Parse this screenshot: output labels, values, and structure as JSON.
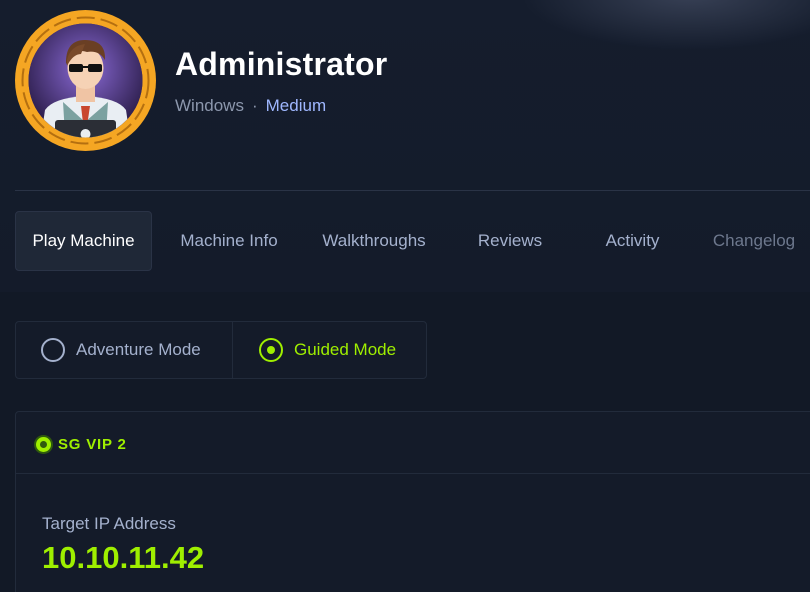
{
  "machine": {
    "name": "Administrator",
    "os": "Windows",
    "separator": "·",
    "difficulty": "Medium",
    "avatar_icon": "hacker-avatar-icon"
  },
  "tabs": [
    {
      "label": "Play Machine",
      "active": true
    },
    {
      "label": "Machine Info",
      "active": false
    },
    {
      "label": "Walkthroughs",
      "active": false
    },
    {
      "label": "Reviews",
      "active": false
    },
    {
      "label": "Activity",
      "active": false
    },
    {
      "label": "Changelog",
      "active": false
    }
  ],
  "modes": {
    "adventure": {
      "label": "Adventure Mode",
      "selected": false
    },
    "guided": {
      "label": "Guided Mode",
      "selected": true
    }
  },
  "server": {
    "name": "SG VIP 2",
    "status": "online",
    "ip_label": "Target IP Address",
    "ip": "10.10.11.42"
  },
  "colors": {
    "accent": "#9fef00",
    "background": "#121926",
    "difficulty": "#9fb7ff",
    "avatar_ring": "#f5a623"
  }
}
